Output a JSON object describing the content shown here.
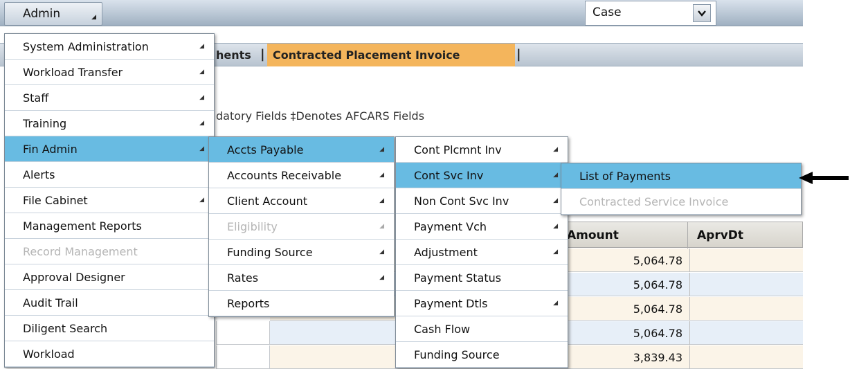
{
  "toolbar": {
    "admin_label": "Admin",
    "case_select_value": "Case",
    "case_dropdown_glyph": "⌵"
  },
  "tabs": {
    "partial_label": "hents",
    "active_label": "Contracted Placement Invoice"
  },
  "legend": {
    "text": "datory Fields   ‡Denotes AFCARS Fields"
  },
  "grid": {
    "columns": [
      "Amount",
      "AprvDt"
    ],
    "rows": [
      {
        "amount": "5,064.78",
        "aprv_dt": ""
      },
      {
        "amount": "5,064.78",
        "aprv_dt": ""
      },
      {
        "amount": "5,064.78",
        "aprv_dt": ""
      },
      {
        "amount": "5,064.78",
        "aprv_dt": ""
      },
      {
        "amount": "3,839.43",
        "aprv_dt": ""
      }
    ]
  },
  "menu_admin": {
    "items": [
      {
        "label": "System Administration",
        "submenu": true
      },
      {
        "label": "Workload Transfer",
        "submenu": true
      },
      {
        "label": "Staff",
        "submenu": true
      },
      {
        "label": "Training",
        "submenu": true
      },
      {
        "label": "Fin Admin",
        "submenu": true,
        "highlighted": true
      },
      {
        "label": "Alerts",
        "submenu": false
      },
      {
        "label": "File Cabinet",
        "submenu": true
      },
      {
        "label": "Management Reports",
        "submenu": false
      },
      {
        "label": "Record Management",
        "submenu": false,
        "disabled": true
      },
      {
        "label": "Approval Designer",
        "submenu": false
      },
      {
        "label": "Audit Trail",
        "submenu": false
      },
      {
        "label": "Diligent Search",
        "submenu": false
      },
      {
        "label": "Workload",
        "submenu": false
      }
    ]
  },
  "menu_fin_admin": {
    "items": [
      {
        "label": "Accts Payable",
        "submenu": true,
        "highlighted": true
      },
      {
        "label": "Accounts Receivable",
        "submenu": true
      },
      {
        "label": "Client Account",
        "submenu": true
      },
      {
        "label": "Eligibility",
        "submenu": true,
        "disabled": true
      },
      {
        "label": "Funding Source",
        "submenu": true
      },
      {
        "label": "Rates",
        "submenu": true
      },
      {
        "label": "Reports",
        "submenu": false
      }
    ]
  },
  "menu_accts_payable": {
    "items": [
      {
        "label": "Cont Plcmnt Inv",
        "submenu": true
      },
      {
        "label": "Cont Svc Inv",
        "submenu": true,
        "highlighted": true
      },
      {
        "label": "Non Cont Svc Inv",
        "submenu": true
      },
      {
        "label": "Payment Vch",
        "submenu": true
      },
      {
        "label": "Adjustment",
        "submenu": true
      },
      {
        "label": "Payment Status",
        "submenu": false
      },
      {
        "label": "Payment Dtls",
        "submenu": true
      },
      {
        "label": "Cash Flow",
        "submenu": false
      },
      {
        "label": "Funding Source",
        "submenu": false
      }
    ]
  },
  "menu_cont_svc_inv": {
    "items": [
      {
        "label": "List of Payments",
        "highlighted": true
      },
      {
        "label": "Contracted Service Invoice",
        "disabled": true
      }
    ]
  },
  "colors": {
    "highlight": "#68bbe2",
    "active_tab": "#f4b55c",
    "disabled_text": "#b5b5b5"
  },
  "submenu_arrow_glyph": "◢"
}
